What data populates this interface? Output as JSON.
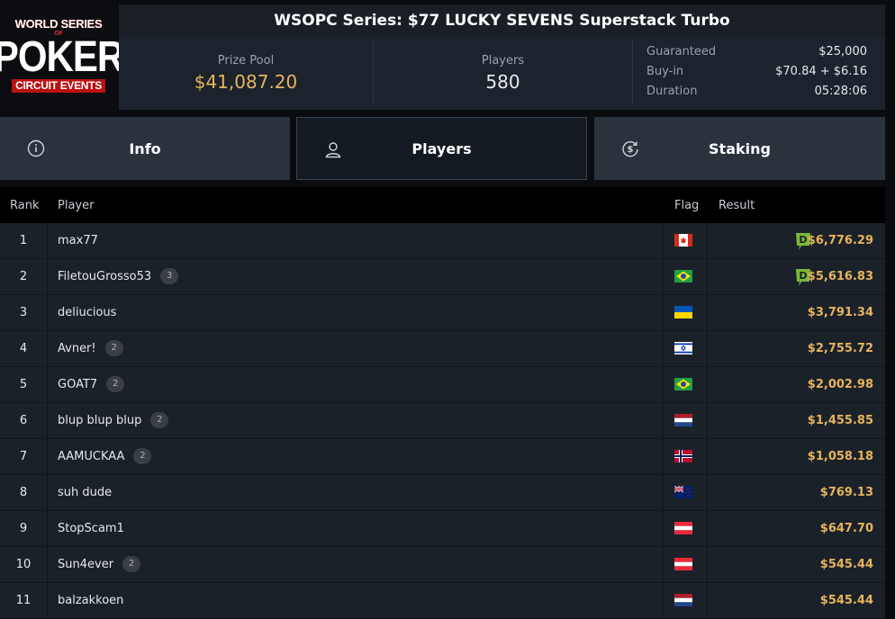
{
  "logo": {
    "line1": "WORLD SERIES",
    "line2": "OF",
    "line3": "POKER",
    "line4": "CIRCUIT EVENTS"
  },
  "tournament": {
    "title": "WSOPC Series: $77 LUCKY SEVENS Superstack Turbo"
  },
  "stats": {
    "prize_pool_label": "Prize Pool",
    "prize_pool_value": "$41,087.20",
    "players_label": "Players",
    "players_value": "580"
  },
  "details": [
    {
      "label": "Guaranteed",
      "value": "$25,000"
    },
    {
      "label": "Buy-in",
      "value": "$70.84 + $6.16"
    },
    {
      "label": "Duration",
      "value": "05:28:06"
    }
  ],
  "tabs": [
    {
      "label": "Info",
      "icon": "info-icon",
      "active": false
    },
    {
      "label": "Players",
      "icon": "user-icon",
      "active": true
    },
    {
      "label": "Staking",
      "icon": "dollar-cycle-icon",
      "active": false
    }
  ],
  "table": {
    "headers": {
      "rank": "Rank",
      "player": "Player",
      "flag": "Flag",
      "result": "Result"
    },
    "rows": [
      {
        "rank": "1",
        "player": "max77",
        "badge": "",
        "flag": "canada",
        "result": "$6,776.29",
        "d_icon": true
      },
      {
        "rank": "2",
        "player": "FiletouGrosso53",
        "badge": "3",
        "flag": "brazil",
        "result": "$5,616.83",
        "d_icon": true
      },
      {
        "rank": "3",
        "player": "deliucious",
        "badge": "",
        "flag": "ukraine",
        "result": "$3,791.34",
        "d_icon": false
      },
      {
        "rank": "4",
        "player": "Avner!",
        "badge": "2",
        "flag": "israel",
        "result": "$2,755.72",
        "d_icon": false
      },
      {
        "rank": "5",
        "player": "GOAT7",
        "badge": "2",
        "flag": "brazil",
        "result": "$2,002.98",
        "d_icon": false
      },
      {
        "rank": "6",
        "player": "blup blup blup",
        "badge": "2",
        "flag": "netherlands",
        "result": "$1,455.85",
        "d_icon": false
      },
      {
        "rank": "7",
        "player": "AAMUCKAA",
        "badge": "2",
        "flag": "norway",
        "result": "$1,058.18",
        "d_icon": false
      },
      {
        "rank": "8",
        "player": "suh dude",
        "badge": "",
        "flag": "new-zealand",
        "result": "$769.13",
        "d_icon": false
      },
      {
        "rank": "9",
        "player": "StopScam1",
        "badge": "",
        "flag": "austria",
        "result": "$647.70",
        "d_icon": false
      },
      {
        "rank": "10",
        "player": "Sun4ever",
        "badge": "2",
        "flag": "austria",
        "result": "$545.44",
        "d_icon": false
      },
      {
        "rank": "11",
        "player": "balzakkoen",
        "badge": "",
        "flag": "netherlands",
        "result": "$545.44",
        "d_icon": false
      }
    ]
  },
  "colors": {
    "accent_gold": "#e6b45c",
    "row_bg": "#1b2129",
    "d_badge_green": "#7cb83a"
  }
}
